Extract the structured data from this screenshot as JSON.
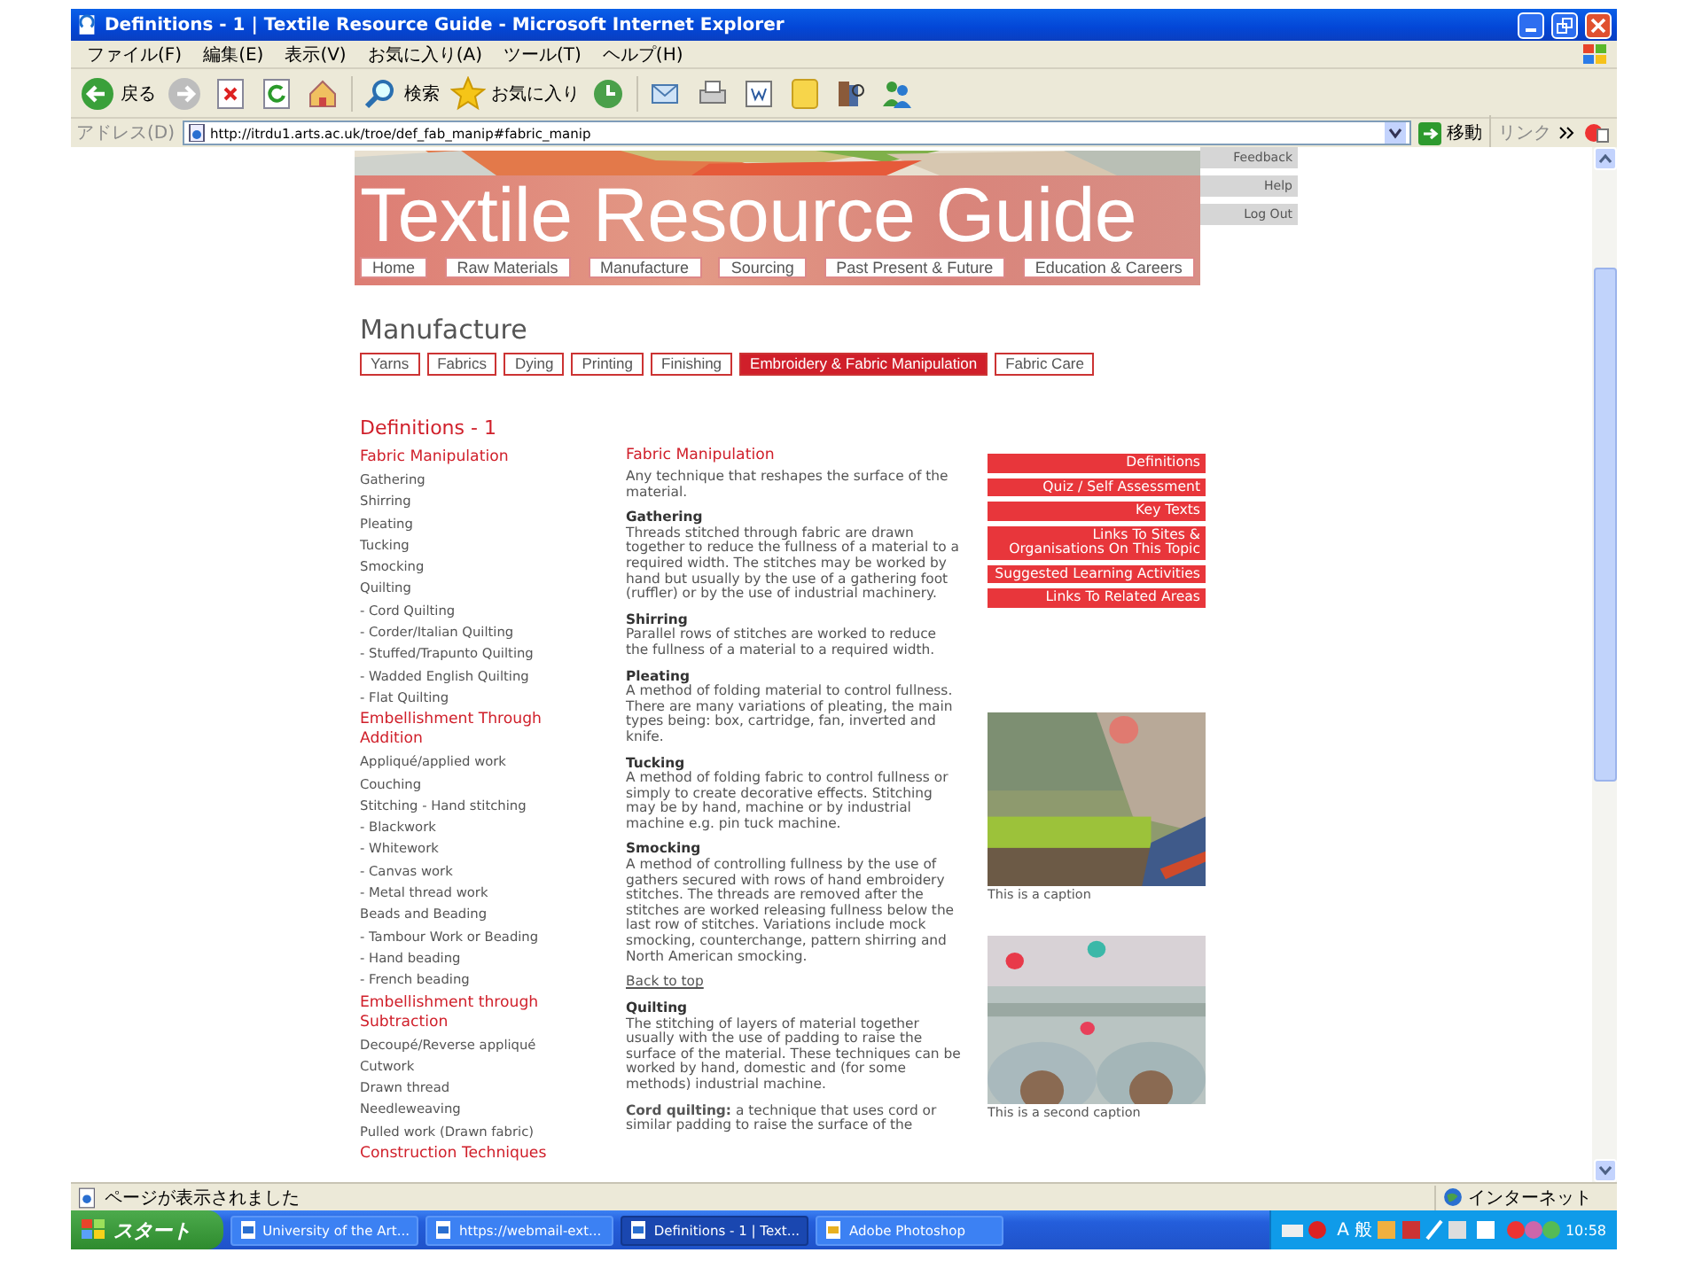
{
  "window": {
    "title": "Definitions - 1 | Textile Resource Guide - Microsoft Internet Explorer"
  },
  "menu": [
    "ファイル(F)",
    "編集(E)",
    "表示(V)",
    "お気に入り(A)",
    "ツール(T)",
    "ヘルプ(H)"
  ],
  "toolbar": {
    "back": "戻る",
    "search": "検索",
    "favorites": "お気に入り"
  },
  "address": {
    "label": "アドレス(D)",
    "url": "http://itrdu1.arts.ac.uk/troe/def_fab_manip#fabric_manip",
    "go": "移動",
    "links": "リンク"
  },
  "site": {
    "title": "Textile Resource Guide",
    "nav": [
      "Home",
      "Raw Materials",
      "Manufacture",
      "Sourcing",
      "Past Present & Future",
      "Education & Careers"
    ],
    "util_links": [
      "Feedback",
      "Help",
      "Log Out"
    ],
    "section": "Manufacture",
    "subtabs": [
      {
        "label": "Yarns",
        "selected": false
      },
      {
        "label": "Fabrics",
        "selected": false
      },
      {
        "label": "Dying",
        "selected": false
      },
      {
        "label": "Printing",
        "selected": false
      },
      {
        "label": "Finishing",
        "selected": false
      },
      {
        "label": "Embroidery & Fabric Manipulation",
        "selected": true
      },
      {
        "label": "Fabric Care",
        "selected": false
      }
    ],
    "heading": "Definitions - 1",
    "sidebar": [
      {
        "kind": "heading",
        "text": "Fabric Manipulation"
      },
      {
        "kind": "item",
        "text": "Gathering"
      },
      {
        "kind": "item",
        "text": "Shirring"
      },
      {
        "kind": "item",
        "text": "Pleating"
      },
      {
        "kind": "item",
        "text": "Tucking"
      },
      {
        "kind": "item",
        "text": "Smocking"
      },
      {
        "kind": "item",
        "text": "Quilting"
      },
      {
        "kind": "item",
        "text": "- Cord Quilting"
      },
      {
        "kind": "item",
        "text": "- Corder/Italian Quilting"
      },
      {
        "kind": "item",
        "text": "- Stuffed/Trapunto Quilting"
      },
      {
        "kind": "item",
        "text": "- Wadded English Quilting"
      },
      {
        "kind": "item",
        "text": "- Flat Quilting"
      },
      {
        "kind": "heading",
        "text": "Embellishment Through Addition"
      },
      {
        "kind": "item",
        "text": "Appliqué/applied work"
      },
      {
        "kind": "item",
        "text": "Couching"
      },
      {
        "kind": "item",
        "text": "Stitching - Hand stitching"
      },
      {
        "kind": "item",
        "text": "- Blackwork"
      },
      {
        "kind": "item",
        "text": "- Whitework"
      },
      {
        "kind": "item",
        "text": "- Canvas work"
      },
      {
        "kind": "item",
        "text": "- Metal thread work"
      },
      {
        "kind": "item",
        "text": "Beads and Beading"
      },
      {
        "kind": "item",
        "text": "- Tambour Work or Beading"
      },
      {
        "kind": "item",
        "text": "- Hand beading"
      },
      {
        "kind": "item",
        "text": "- French beading"
      },
      {
        "kind": "heading",
        "text": "Embellishment through Subtraction"
      },
      {
        "kind": "item",
        "text": "Decoupé/Reverse appliqué"
      },
      {
        "kind": "item",
        "text": "Cutwork"
      },
      {
        "kind": "item",
        "text": "Drawn thread"
      },
      {
        "kind": "item",
        "text": "Needleweaving"
      },
      {
        "kind": "item",
        "text": "Pulled work (Drawn fabric)"
      },
      {
        "kind": "heading",
        "text": "Construction Techniques"
      }
    ],
    "content": [
      {
        "kind": "title",
        "text": "Fabric Manipulation"
      },
      {
        "kind": "para",
        "text": "Any technique that reshapes the surface of the material."
      },
      {
        "kind": "entry",
        "term": "Gathering",
        "text": "Threads stitched through fabric are drawn together to reduce the fullness of a material to a required width. The stitches may be worked by hand but usually by the use of a gathering foot (ruffler) or by the use of industrial machinery."
      },
      {
        "kind": "entry",
        "term": "Shirring",
        "text": "Parallel rows of stitches are worked to reduce the fullness of a material to a required width."
      },
      {
        "kind": "entry",
        "term": "Pleating",
        "text": "A method of folding material to control fullness. There are many variations of pleating, the main types being: box, cartridge, fan, inverted and knife."
      },
      {
        "kind": "entry",
        "term": "Tucking",
        "text": "A method of folding fabric to control fullness or simply to create decorative effects. Stitching may be by hand, machine or by industrial machine e.g. pin tuck machine."
      },
      {
        "kind": "entry",
        "term": "Smocking",
        "text": "A method of controlling fullness by the use of gathers secured with rows of hand embroidery stitches. The threads are removed after the stitches are worked releasing fullness below the last row of stitches. Variations include mock smocking, counterchange, pattern shirring and North American smocking."
      },
      {
        "kind": "link",
        "text": "Back to top"
      },
      {
        "kind": "entry",
        "term": "Quilting",
        "text": "The stitching of layers of material together usually with the use of padding to raise the surface of the material. These techniques can be worked by hand, domestic and (for some methods) industrial machine."
      },
      {
        "kind": "para",
        "text": "**Cord quilting:** a technique that uses cord or similar padding to raise the surface of the"
      }
    ],
    "side_links": [
      "Definitions",
      "Quiz / Self Assessment",
      "Key Texts",
      "Links To Sites & Organisations On This Topic",
      "Suggested Learning Activities",
      "Links To Related Areas"
    ],
    "figures": [
      {
        "caption": "This is a caption"
      },
      {
        "caption": "This is a second caption"
      }
    ]
  },
  "status_bar": {
    "text": "ページが表示されました",
    "zone": "インターネット"
  },
  "taskbar": {
    "start": "スタート",
    "tasks": [
      {
        "label": "University of the Art...",
        "selected": false
      },
      {
        "label": "https://webmail-ext...",
        "selected": false
      },
      {
        "label": "Definitions - 1 | Text...",
        "selected": true
      },
      {
        "label": "Adobe Photoshop",
        "selected": false
      }
    ],
    "ime_mode": "A",
    "ime_kanji": "般",
    "clock": "10:58"
  }
}
